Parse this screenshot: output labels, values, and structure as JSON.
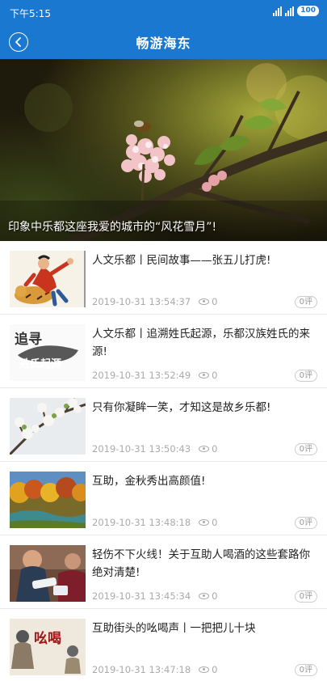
{
  "status_bar": {
    "time": "下午5:15",
    "battery": "100"
  },
  "header": {
    "title": "畅游海东"
  },
  "banner": {
    "caption": "印象中乐都这座我爱的城市的“风花雪月”!"
  },
  "articles": [
    {
      "title": "人文乐都丨民间故事——张五儿打虎!",
      "date": "2019-10-31 13:54:37",
      "views": "0",
      "comments": "0评"
    },
    {
      "title": "人文乐都丨追溯姓氏起源，乐都汉族姓氏的来源!",
      "date": "2019-10-31 13:52:49",
      "views": "0",
      "comments": "0评",
      "thumb_text_1": "追寻",
      "thumb_text_2": "姓氏起源"
    },
    {
      "title": "只有你凝眸一笑，才知这是故乡乐都!",
      "date": "2019-10-31 13:50:43",
      "views": "0",
      "comments": "0评"
    },
    {
      "title": "互助，金秋秀出高颜值!",
      "date": "2019-10-31 13:48:18",
      "views": "0",
      "comments": "0评"
    },
    {
      "title": "轻伤不下火线！关于互助人喝酒的这些套路你绝对清楚!",
      "date": "2019-10-31 13:45:34",
      "views": "0",
      "comments": "0评"
    },
    {
      "title": "互助街头的吆喝声丨一把把儿十块",
      "date": "2019-10-31 13:47:18",
      "views": "0",
      "comments": "0评",
      "thumb_text_1": "吆喝"
    }
  ]
}
